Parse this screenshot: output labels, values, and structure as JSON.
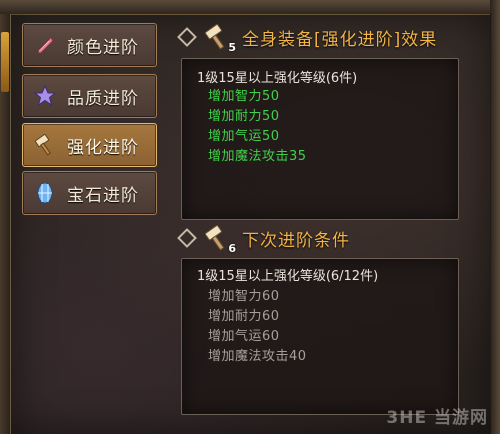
{
  "tabs": [
    {
      "label": "颜色进阶",
      "icon": "feather-icon",
      "active": false
    },
    {
      "label": "品质进阶",
      "icon": "star-icon",
      "active": false
    },
    {
      "label": "强化进阶",
      "icon": "hammer-icon",
      "active": true
    },
    {
      "label": "宝石进阶",
      "icon": "gem-icon",
      "active": false
    }
  ],
  "current_effect": {
    "title": "全身装备[强化进阶]效果",
    "level_badge": "5",
    "requirement": "1级15星以上强化等级(6件)",
    "stats": [
      "增加智力50",
      "增加耐力50",
      "增加气运50",
      "增加魔法攻击35"
    ]
  },
  "next_condition": {
    "title": "下次进阶条件",
    "level_badge": "6",
    "requirement": "1级15星以上强化等级(6/12件)",
    "stats": [
      "增加智力60",
      "增加耐力60",
      "增加气运60",
      "增加魔法攻击40"
    ]
  },
  "watermark": "3HE 当游网",
  "colors": {
    "title": "#f1b246",
    "active_stat": "#3fd24a",
    "inactive_stat": "#a5a09a",
    "active_tab": "#a6773e"
  }
}
